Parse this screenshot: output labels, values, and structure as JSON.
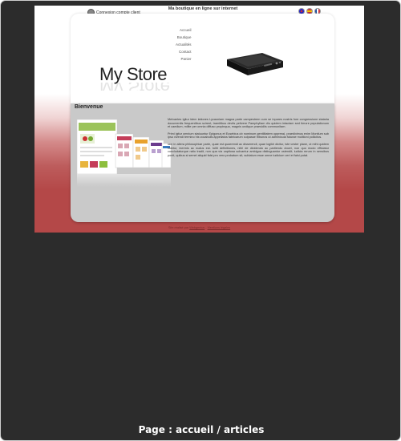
{
  "topbar": {
    "login_label": "Connexion compte client",
    "tagline": "Ma boutique en ligne sur internet"
  },
  "flags": [
    "flag-uk-icon",
    "flag-es-icon",
    "flag-fr-icon"
  ],
  "nav": {
    "items": [
      "Accueil",
      "Boutique",
      "Actualités",
      "Contact",
      "Panier"
    ]
  },
  "logo": {
    "text": "My Store"
  },
  "section": {
    "title": "Bienvenue"
  },
  "paragraphs": [
    "Melvantes igitur idem lationes Lycaoniam magna parte campestrem cum se inpares nostris fore congressione stataria documentis frequentibus scirent, tramitibus deviis petivere Pamphyliam diu quidem intactam sed timore populationum et caedium, milite per omnia diffuso propinqua, magnis undique praesidiis communitam.",
    "Primi igitur omnium statuuntur Epigonus et Eusebius ob nominum gentilitatem oppressi. praediximus enim Montium sub ipso vivendi termino his vocabulis appellatos fabricarum culpasse tribunos ut adminicula futurae molitioni pollicitos.",
    "Iam in altera philosophiae parte, quae est quaerendi ac disserendi, quae logikh dicitur, iste vester plane, ut mihi quidem videtur, inermis ac nudus est. tollit definitiones, nihil de dividendo ac partiendo docet, non quo modo efficiatur concludaturque ratio tradit, non qua via captiosa solvantur ambigua distinguantur ostendit; iudicia rerum in sensibus ponit, quibus si semel aliquid falsi pro vero probatum sit, sublatum esse omne iudicium veri et falsi putat."
  ],
  "footer": {
    "prefix": "Site réalisé par",
    "link1": "Webgenius",
    "sep": " - ",
    "link2": "Mentions légales"
  },
  "caption": "Page : accueil / articles",
  "colors": {
    "frame_bg": "#2c2c2c",
    "accent_red": "#b44848",
    "panel_gray": "#c9c9c9"
  }
}
